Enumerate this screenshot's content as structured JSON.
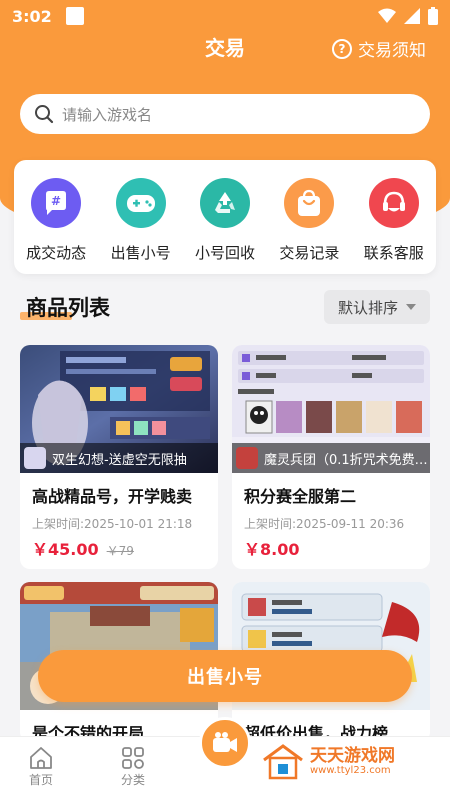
{
  "status": {
    "time": "3:02"
  },
  "header": {
    "title": "交易",
    "rules_label": "交易须知"
  },
  "search": {
    "placeholder": "请输入游戏名"
  },
  "quick_actions": [
    {
      "label": "成交动态",
      "icon": "hashtag-chat-icon",
      "color": "#6d5cf2"
    },
    {
      "label": "出售小号",
      "icon": "gamepad-icon",
      "color": "#2fbfb3"
    },
    {
      "label": "小号回收",
      "icon": "recycle-icon",
      "color": "#2bb8a6"
    },
    {
      "label": "交易记录",
      "icon": "shopping-bag-icon",
      "color": "#fb9b4a"
    },
    {
      "label": "联系客服",
      "icon": "headset-icon",
      "color": "#f0474f"
    }
  ],
  "list": {
    "title": "商品列表",
    "sort_label": "默认排序"
  },
  "products": [
    {
      "game": "双生幻想-送虚空无限抽",
      "title": "高战精品号，开学贱卖",
      "time": "上架时间:2025-10-01 21:18",
      "price": "￥45.00",
      "old_price": "￥79"
    },
    {
      "game": "魔灵兵团（0.1折咒术免费…",
      "title": "积分赛全服第二",
      "time": "上架时间:2025-09-11 20:36",
      "price": "￥8.00",
      "old_price": ""
    },
    {
      "game": "",
      "title": "是个不错的开局",
      "time": "",
      "price": "",
      "old_price": ""
    },
    {
      "game": "",
      "title": "超低价出售，战力榜",
      "time": "",
      "price": "",
      "old_price": ""
    }
  ],
  "sell_button": "出售小号",
  "nav": [
    {
      "label": "首页",
      "icon": "home-icon"
    },
    {
      "label": "分类",
      "icon": "category-icon"
    },
    {
      "label": "",
      "icon": "video-camera-icon"
    }
  ],
  "watermark": {
    "line1": "天天游戏网",
    "line2": "www.ttyl23.com"
  },
  "colors": {
    "accent": "#fa9a3c",
    "price": "#e8213b"
  }
}
